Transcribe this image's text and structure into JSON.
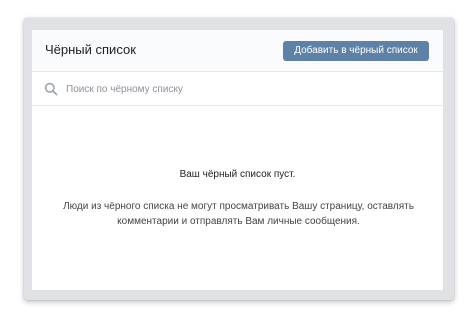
{
  "blacklist": {
    "title": "Чёрный список",
    "add_button_label": "Добавить в чёрный список",
    "search": {
      "placeholder": "Поиск по чёрному списку",
      "value": "",
      "icon": "search-icon"
    },
    "empty_state": {
      "title": "Ваш чёрный список пуст.",
      "description": "Люди из чёрного списка не могут просматривать Вашу страницу, оставлять комментарии и отправлять Вам личные сообщения."
    }
  },
  "colors": {
    "accent_button": "#5e81a8",
    "header_background": "#fafbfc",
    "border": "#e7e8ec",
    "placeholder_text": "#8a929b"
  }
}
